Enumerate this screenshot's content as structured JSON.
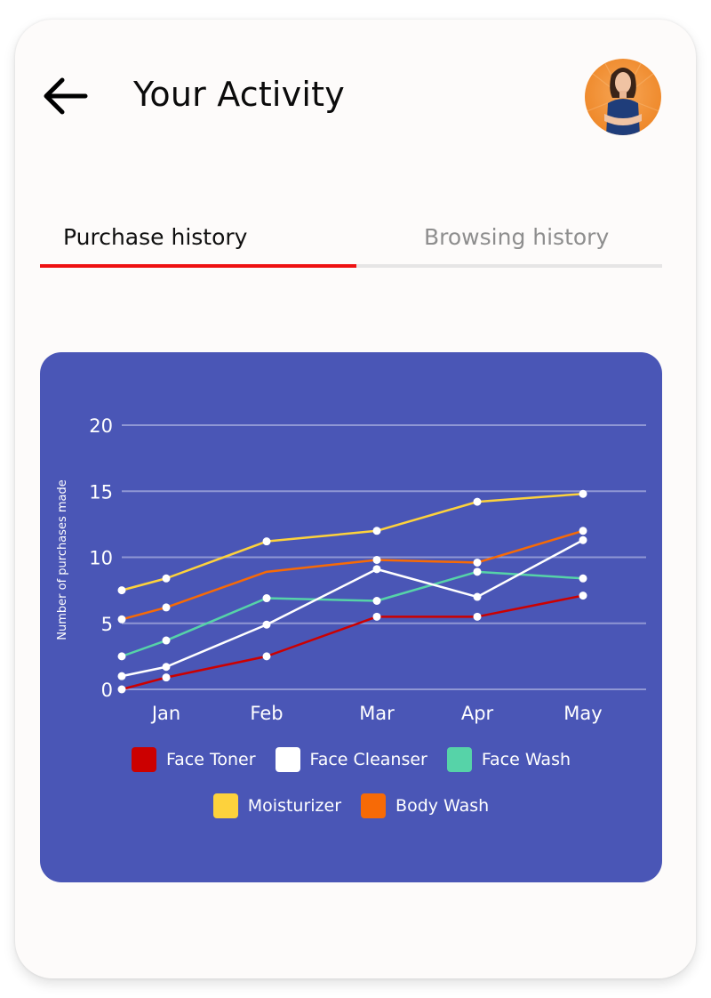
{
  "header": {
    "title": "Your Activity",
    "back_icon": "arrow-left-icon",
    "avatar_icon": "user-avatar"
  },
  "tabs": [
    {
      "label": "Purchase history",
      "active": true
    },
    {
      "label": "Browsing  history",
      "active": false
    }
  ],
  "colors": {
    "accent": "#ee1111",
    "chart_bg": "#4a56b6",
    "grid": "#8f97d4"
  },
  "chart_data": {
    "type": "line",
    "title": "",
    "xlabel": "",
    "ylabel": "Number of purchases made",
    "x_ticks": [
      "Jan",
      "Feb",
      "Mar",
      "Apr",
      "May"
    ],
    "y_ticks": [
      "0",
      "5",
      "10",
      "15",
      "20"
    ],
    "ylim": [
      0,
      20
    ],
    "grid": true,
    "legend_position": "bottom",
    "x": [
      0.55,
      1,
      2,
      3,
      4,
      5
    ],
    "series": [
      {
        "name": "Face Toner",
        "color": "#cc0000",
        "values": [
          0,
          0.9,
          2.5,
          5.5,
          5.5,
          7.1
        ],
        "markers": [
          true,
          true,
          true,
          true,
          true,
          true
        ]
      },
      {
        "name": "Face Cleanser",
        "color": "#ffffff",
        "values": [
          1.0,
          1.7,
          4.9,
          9.1,
          7.0,
          11.3
        ],
        "markers": [
          true,
          true,
          true,
          true,
          true,
          true
        ]
      },
      {
        "name": "Face Wash",
        "color": "#56d3a8",
        "values": [
          2.5,
          3.7,
          6.9,
          6.7,
          8.9,
          8.4
        ],
        "markers": [
          true,
          true,
          true,
          true,
          true,
          true
        ]
      },
      {
        "name": "Moisturizer",
        "color": "#fdd23c",
        "values": [
          7.5,
          8.4,
          11.2,
          12.0,
          14.2,
          14.8
        ],
        "markers": [
          true,
          true,
          true,
          true,
          true,
          true
        ]
      },
      {
        "name": "Body Wash",
        "color": "#f76a06",
        "values": [
          5.3,
          6.2,
          8.9,
          9.8,
          9.6,
          12.0
        ],
        "markers": [
          true,
          true,
          false,
          true,
          true,
          true
        ]
      }
    ],
    "legend": [
      [
        "Face Toner",
        "Face Cleanser",
        "Face Wash"
      ],
      [
        "Moisturizer",
        "Body Wash"
      ]
    ]
  }
}
